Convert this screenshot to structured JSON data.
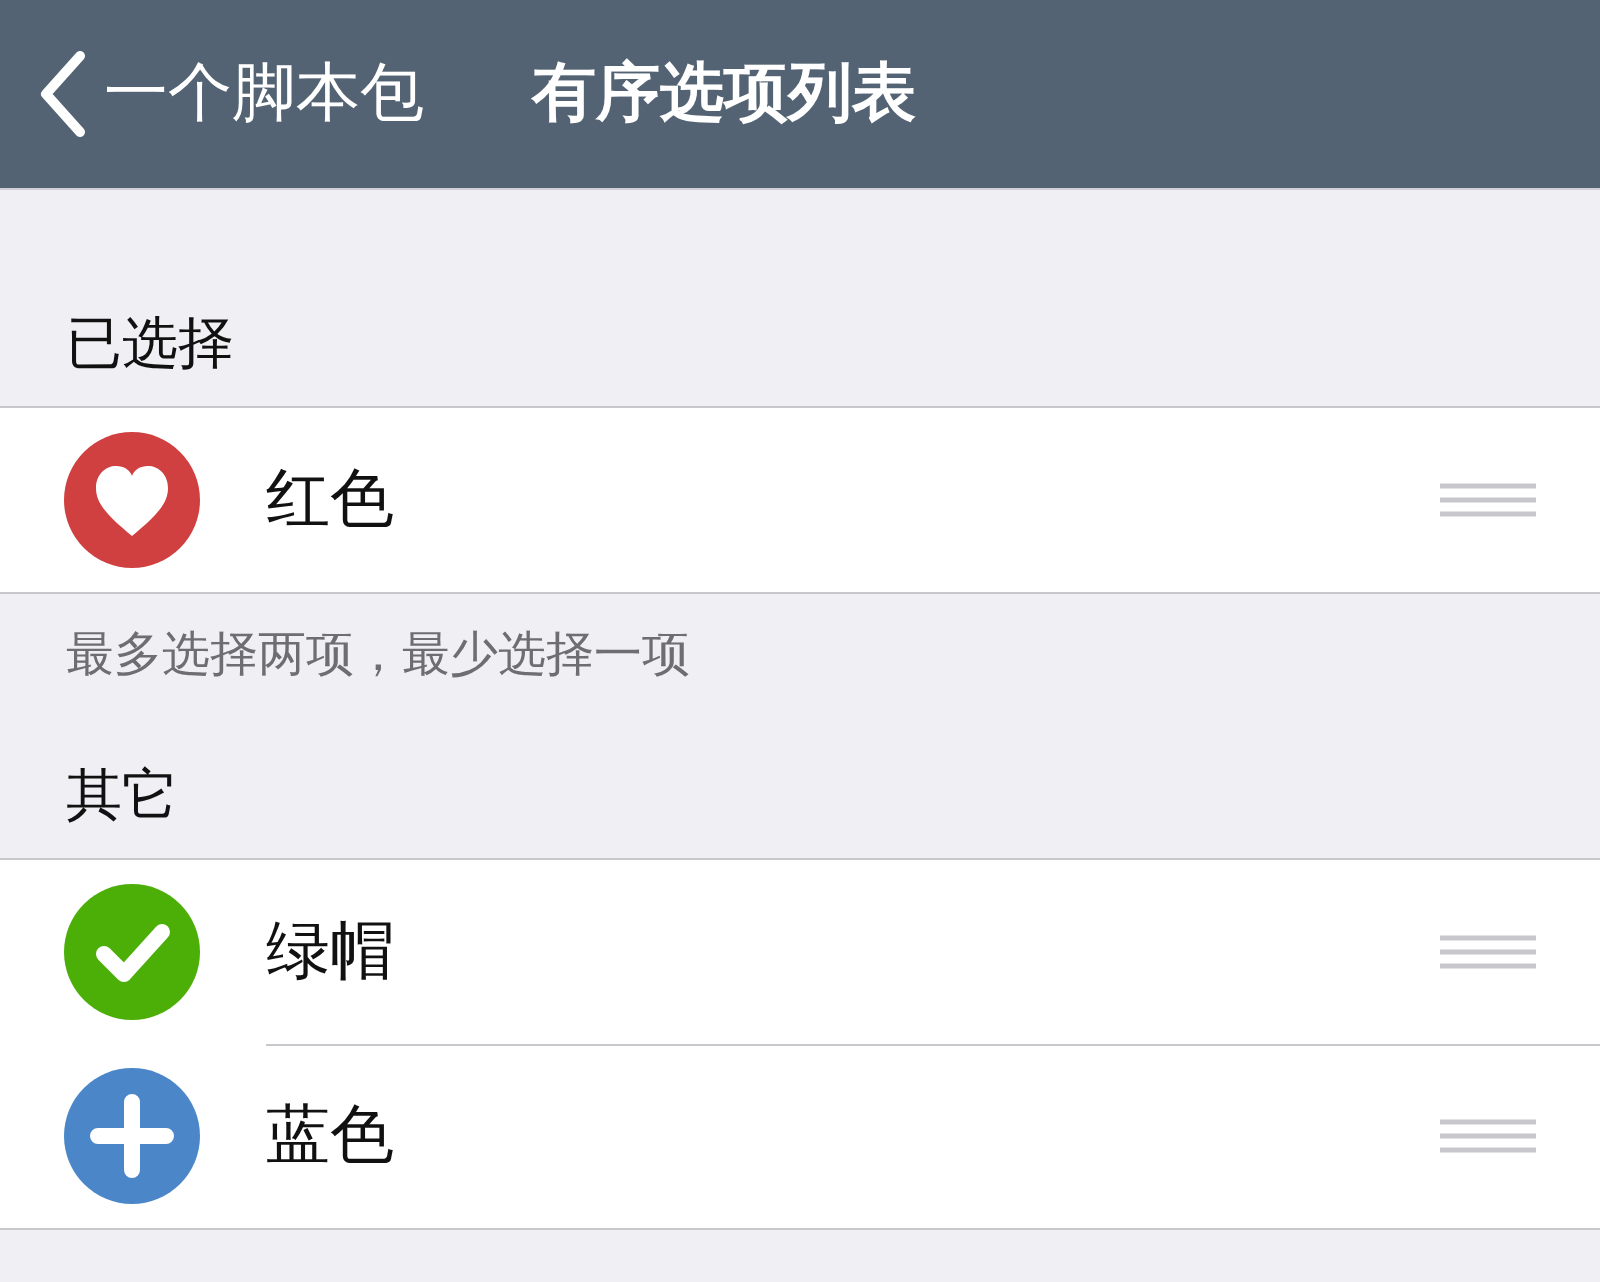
{
  "nav_bar": {
    "back_label": "一个脚本包",
    "title": "有序选项列表"
  },
  "sections": [
    {
      "header": "已选择",
      "items": [
        {
          "label": "红色",
          "kind": "heart",
          "color": "#d04040"
        }
      ],
      "footer": "最多选择两项，最少选择一项"
    },
    {
      "header": "其它",
      "items": [
        {
          "label": "绿帽",
          "kind": "check",
          "color": "#4caf08"
        },
        {
          "label": "蓝色",
          "kind": "plus",
          "color": "#4a86c8"
        }
      ]
    }
  ]
}
